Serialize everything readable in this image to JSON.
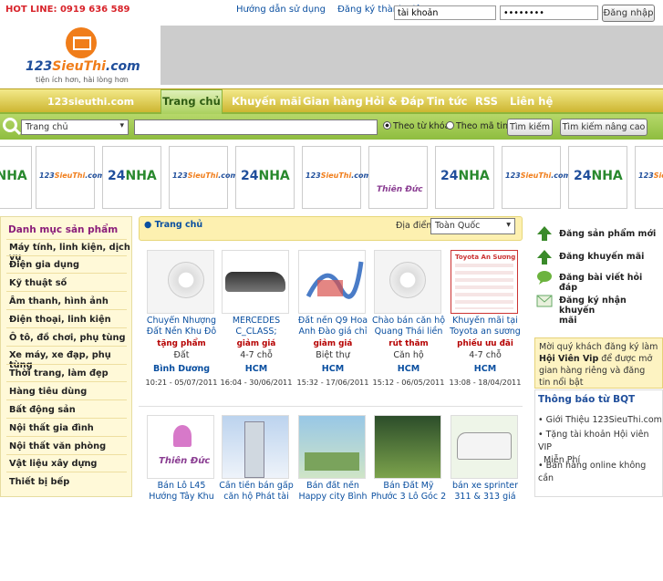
{
  "topbar": {
    "hotline": "HOT LINE: 0919 636 589",
    "links": [
      "Hướng dẫn sử dụng",
      "Đăng ký thành viên"
    ],
    "username": "tài khoản",
    "password": "••••••••",
    "login_label": "Đăng nhập"
  },
  "logo": {
    "brand_a": "123",
    "brand_b": "SieuThi",
    "brand_c": ".com",
    "slogan": "tiện ích hơn, hài lòng hơn"
  },
  "nav": {
    "site": "123sieuthi.com",
    "active": "Trang chủ",
    "items": [
      "Khuyến mãi",
      "Gian hàng",
      "Hỏi & Đáp",
      "Tin tức",
      "RSS",
      "Liên hệ"
    ]
  },
  "search": {
    "category": "Trang chủ",
    "query": "",
    "radio_keyword": "Theo từ khóa",
    "radio_code": "Theo mã tin",
    "search_label": "Tìm kiếm",
    "advanced_label": "Tìm kiếm nâng cao"
  },
  "strip": {
    "logo_a": "123",
    "logo_b": "SieuThi",
    "logo_c": ".com",
    "nha_a": "24",
    "nha_b": "NHA",
    "thienduc": "Thiên Đức"
  },
  "sidebar": {
    "title": "Danh mục sản phẩm",
    "items": [
      "Máy tính, linh kiện, dịch vụ",
      "Điện gia dụng",
      "Kỹ thuật số",
      "Âm thanh, hình ảnh",
      "Điện thoại, linh kiện",
      "Ô tô, đồ chơi, phụ tùng",
      "Xe máy, xe đạp, phụ tùng",
      "Thời trang, làm đẹp",
      "Hàng tiêu dùng",
      "Bất động sản",
      "Nội thất gia đình",
      "Nội thất văn phòng",
      "Vật liệu xây dựng",
      "Thiết bị bếp"
    ]
  },
  "main": {
    "breadcrumb": "Trang chủ",
    "location_label": "Địa điểm",
    "location_value": "Toàn Quốc",
    "ad_label": "Toyota An Sương",
    "cards": [
      {
        "title": "Chuyển Nhượng Đất Nền Khu Đô",
        "tag": "tặng phẩm",
        "cat": "Đất",
        "loc": "Bình Dương",
        "date": "10:21 - 05/07/2011"
      },
      {
        "title": "MERCEDES C_CLASS;",
        "tag": "giảm giá",
        "cat": "4-7 chỗ",
        "loc": "HCM",
        "date": "16:04 - 30/06/2011"
      },
      {
        "title": "Đất nền Q9 Hoa Anh Đào giá chỉ",
        "tag": "giảm giá",
        "cat": "Biệt thự",
        "loc": "HCM",
        "date": "15:32 - 17/06/2011"
      },
      {
        "title": "Chào bán căn hộ Quang Thái liền",
        "tag": "rút thăm",
        "cat": "Căn hộ",
        "loc": "HCM",
        "date": "15:12 - 06/05/2011"
      },
      {
        "title": "Khuyến mãi tại Toyota an sương",
        "tag": "phiếu ưu đãi",
        "cat": "4-7 chỗ",
        "loc": "HCM",
        "date": "13:08 - 18/04/2011"
      }
    ],
    "row2": [
      {
        "title": "Bán Lô L45 Hướng Tây Khu"
      },
      {
        "title": "Cần tiền bán gấp căn hộ Phát tài"
      },
      {
        "title": "Bán đất nền Happy city Bình"
      },
      {
        "title": "Bán Đất Mỹ Phước 3 Lô Góc 2"
      },
      {
        "title": "bán xe sprinter 311 & 313 giá"
      }
    ]
  },
  "right": {
    "actions": [
      "Đăng sản phẩm mới",
      "Đăng khuyến mãi",
      "Đăng bài viết hỏi đáp",
      "Đăng ký nhận khuyến",
      "mãi"
    ],
    "vip_1": "Mời quý khách đăng ký làm",
    "vip_2": "Hội Viên Vip",
    "vip_3": "để được mở gian hàng riêng và đăng tin nổi bật",
    "bqt_title": "Thông báo từ BQT",
    "bqt_items": [
      "Giới Thiệu 123SieuThi.com",
      "Tặng tài khoản Hội viên VIP",
      "Miễn Phí",
      "Bán hàng online không cần"
    ]
  },
  "colors": {
    "accent_green": "#8ebd3f",
    "nav_yellow": "#e4d45a",
    "link_blue": "#0a4fa0",
    "price_red": "#b50000"
  }
}
